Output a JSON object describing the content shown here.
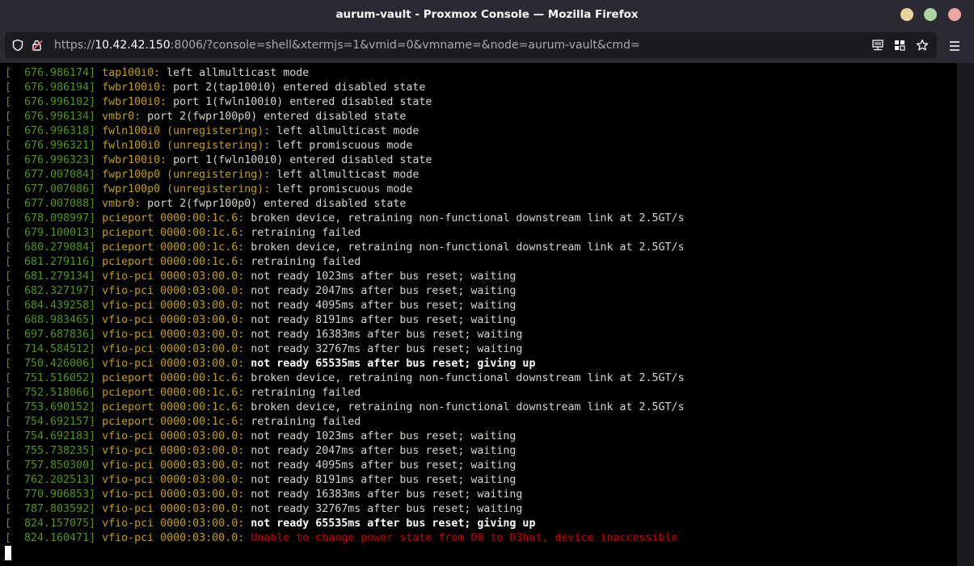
{
  "window": {
    "title": "aurum-vault - Proxmox Console — Mozilla Firefox"
  },
  "urlbar": {
    "scheme": "https://",
    "host": "10.42.42.150",
    "rest": ":8006/?console=shell&xtermjs=1&vmid=0&vmname=&node=aurum-vault&cmd="
  },
  "colors": {
    "timestamp": "#4e9a06",
    "source": "#c4a000",
    "message": "#d3d7cf",
    "error": "#cc0000"
  },
  "terminal": {
    "lines": [
      {
        "ts": "[  676.986174]",
        "src": " tap100i0:",
        "msg": " left allmulticast mode",
        "style": ""
      },
      {
        "ts": "[  676.986194]",
        "src": " fwbr100i0:",
        "msg": " port 2(tap100i0) entered disabled state",
        "style": ""
      },
      {
        "ts": "[  676.996102]",
        "src": " fwbr100i0:",
        "msg": " port 1(fwln100i0) entered disabled state",
        "style": ""
      },
      {
        "ts": "[  676.996134]",
        "src": " vmbr0:",
        "msg": " port 2(fwpr100p0) entered disabled state",
        "style": ""
      },
      {
        "ts": "[  676.996318]",
        "src": " fwln100i0 (unregistering):",
        "msg": " left allmulticast mode",
        "style": ""
      },
      {
        "ts": "[  676.996321]",
        "src": " fwln100i0 (unregistering):",
        "msg": " left promiscuous mode",
        "style": ""
      },
      {
        "ts": "[  676.996323]",
        "src": " fwbr100i0:",
        "msg": " port 1(fwln100i0) entered disabled state",
        "style": ""
      },
      {
        "ts": "[  677.007084]",
        "src": " fwpr100p0 (unregistering):",
        "msg": " left allmulticast mode",
        "style": ""
      },
      {
        "ts": "[  677.007086]",
        "src": " fwpr100p0 (unregistering):",
        "msg": " left promiscuous mode",
        "style": ""
      },
      {
        "ts": "[  677.007088]",
        "src": " vmbr0:",
        "msg": " port 2(fwpr100p0) entered disabled state",
        "style": ""
      },
      {
        "ts": "[  678.098997]",
        "src": " pcieport 0000:00:1c.6:",
        "msg": " broken device, retraining non-functional downstream link at 2.5GT/s",
        "style": ""
      },
      {
        "ts": "[  679.100013]",
        "src": " pcieport 0000:00:1c.6:",
        "msg": " retraining failed",
        "style": ""
      },
      {
        "ts": "[  680.279084]",
        "src": " pcieport 0000:00:1c.6:",
        "msg": " broken device, retraining non-functional downstream link at 2.5GT/s",
        "style": ""
      },
      {
        "ts": "[  681.279116]",
        "src": " pcieport 0000:00:1c.6:",
        "msg": " retraining failed",
        "style": ""
      },
      {
        "ts": "[  681.279134]",
        "src": " vfio-pci 0000:03:00.0:",
        "msg": " not ready 1023ms after bus reset; waiting",
        "style": ""
      },
      {
        "ts": "[  682.327197]",
        "src": " vfio-pci 0000:03:00.0:",
        "msg": " not ready 2047ms after bus reset; waiting",
        "style": ""
      },
      {
        "ts": "[  684.439258]",
        "src": " vfio-pci 0000:03:00.0:",
        "msg": " not ready 4095ms after bus reset; waiting",
        "style": ""
      },
      {
        "ts": "[  688.983465]",
        "src": " vfio-pci 0000:03:00.0:",
        "msg": " not ready 8191ms after bus reset; waiting",
        "style": ""
      },
      {
        "ts": "[  697.687836]",
        "src": " vfio-pci 0000:03:00.0:",
        "msg": " not ready 16383ms after bus reset; waiting",
        "style": ""
      },
      {
        "ts": "[  714.584512]",
        "src": " vfio-pci 0000:03:00.0:",
        "msg": " not ready 32767ms after bus reset; waiting",
        "style": ""
      },
      {
        "ts": "[  750.426006]",
        "src": " vfio-pci 0000:03:00.0:",
        "msg": " not ready 65535ms after bus reset; giving up",
        "style": "bold"
      },
      {
        "ts": "[  751.516052]",
        "src": " pcieport 0000:00:1c.6:",
        "msg": " broken device, retraining non-functional downstream link at 2.5GT/s",
        "style": ""
      },
      {
        "ts": "[  752.518066]",
        "src": " pcieport 0000:00:1c.6:",
        "msg": " retraining failed",
        "style": ""
      },
      {
        "ts": "[  753.690152]",
        "src": " pcieport 0000:00:1c.6:",
        "msg": " broken device, retraining non-functional downstream link at 2.5GT/s",
        "style": ""
      },
      {
        "ts": "[  754.692157]",
        "src": " pcieport 0000:00:1c.6:",
        "msg": " retraining failed",
        "style": ""
      },
      {
        "ts": "[  754.692183]",
        "src": " vfio-pci 0000:03:00.0:",
        "msg": " not ready 1023ms after bus reset; waiting",
        "style": ""
      },
      {
        "ts": "[  755.738235]",
        "src": " vfio-pci 0000:03:00.0:",
        "msg": " not ready 2047ms after bus reset; waiting",
        "style": ""
      },
      {
        "ts": "[  757.850300]",
        "src": " vfio-pci 0000:03:00.0:",
        "msg": " not ready 4095ms after bus reset; waiting",
        "style": ""
      },
      {
        "ts": "[  762.202513]",
        "src": " vfio-pci 0000:03:00.0:",
        "msg": " not ready 8191ms after bus reset; waiting",
        "style": ""
      },
      {
        "ts": "[  770.906853]",
        "src": " vfio-pci 0000:03:00.0:",
        "msg": " not ready 16383ms after bus reset; waiting",
        "style": ""
      },
      {
        "ts": "[  787.803592]",
        "src": " vfio-pci 0000:03:00.0:",
        "msg": " not ready 32767ms after bus reset; waiting",
        "style": ""
      },
      {
        "ts": "[  824.157075]",
        "src": " vfio-pci 0000:03:00.0:",
        "msg": " not ready 65535ms after bus reset; giving up",
        "style": "bold"
      },
      {
        "ts": "[  824.160471]",
        "src": " vfio-pci 0000:03:00.0:",
        "msg": " Unable to change power state from D0 to D3hot, device inaccessible",
        "style": "err"
      }
    ]
  }
}
